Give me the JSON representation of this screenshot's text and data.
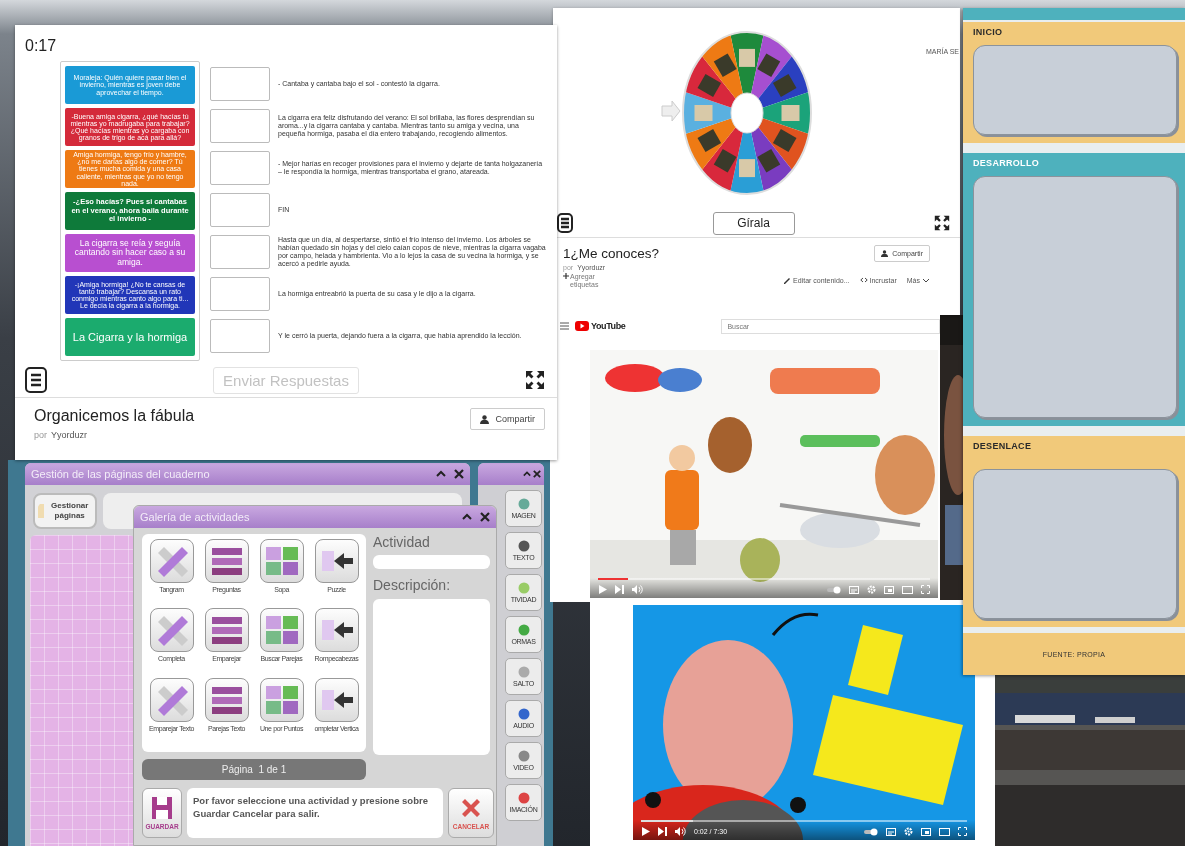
{
  "quiz": {
    "timer": "0:17",
    "cards": [
      {
        "kind": "dense",
        "color": "#1a9ad6",
        "text": "Moraleja: Quién quiere pasar bien el invierno, mientras es joven debe aprovechar el tiempo."
      },
      {
        "kind": "dense",
        "color": "#d42a3a",
        "text": "-Buena amiga cigarra, ¿qué hacías tú mientras yo madrugaba para trabajar? ¿Qué hacías mientras yo cargaba con granos de trigo de acá para allá?"
      },
      {
        "kind": "dense",
        "color": "#ee7a14",
        "text": "Amiga hormiga, tengo frío y hambre, ¿no me darías algo de comer? Tú tienes mucha comida y una casa caliente, mientras que yo no tengo nada."
      },
      {
        "kind": "short",
        "color": "#0e7a3a",
        "text": "-¿Eso hacías? Pues si cantabas en el verano, ahora baila durante el invierno -"
      },
      {
        "kind": "medium",
        "color": "#b84fd0",
        "text": "La cigarra se reía y seguía cantando sin hacer caso a su amiga."
      },
      {
        "kind": "dense",
        "color": "#2136b8",
        "text": "-¡Amiga hormiga! ¿No te cansas de tanto trabajar? Descansa un rato conmigo mientras canto algo para ti... Le decía la cigarra a la hormiga."
      },
      {
        "kind": "heading",
        "color": "#1bab6e",
        "text": "La Cigarra y la hormiga"
      }
    ],
    "slots": [
      {
        "text": "- Cantaba y cantaba bajo el sol - contestó la cigarra."
      },
      {
        "text": "La cigarra era feliz disfrutando del verano: El sol brillaba, las flores desprendían su aroma...y la cigarra cantaba y cantaba. Mientras tanto su amiga y vecina, una pequeña hormiga, pasaba el día entero trabajando, recogiendo alimentos."
      },
      {
        "text": "- Mejor harías en recoger provisiones para el invierno y dejarte de tanta holgazanería – le respondía la hormiga, mientras transportaba el grano, atareada."
      },
      {
        "text": "FIN"
      },
      {
        "text": "Hasta que un día, al despertarse, sintió el frío intenso del invierno. Los árboles se habían quedado sin hojas y del cielo caían copos de nieve, mientras la cigarra vagaba por campo, helada y hambrienta. Vio a lo lejos la casa de su vecina la hormiga, y se acercó a pedirle ayuda."
      },
      {
        "text": "La hormiga entreabrió la puerta de su casa y le dijo a la cigarra."
      },
      {
        "text": "Y le cerró la puerta, dejando fuera a la cigarra, que había aprendido la lección."
      }
    ],
    "submit": {
      "label": "Enviar Respuestas",
      "disabled": true
    },
    "title": "Organicemos la fábula",
    "byline": "por",
    "author": "Yyorduzr",
    "share": "Compartir"
  },
  "wheel": {
    "corner_text": "MARÍA SE",
    "spin_button": "Gírala",
    "title": "1¿Me conoces?",
    "byline": "por",
    "author": "Yyorduzr",
    "share": "Compartir",
    "add_tags": "Agregar etiquetas",
    "actions": [
      {
        "kind": "edit",
        "label": "Editar contenido..."
      },
      {
        "kind": "embed",
        "label": "Incrustar"
      },
      {
        "kind": "more",
        "label": "Más"
      }
    ]
  },
  "video_1": {
    "site": "YouTube",
    "search_placeholder": "Buscar",
    "progress": {
      "level": 0.09
    }
  },
  "video_2": {
    "time": "0:02 / 7:30",
    "progress": {
      "level": 0.16
    }
  },
  "organizer": {
    "sections": [
      {
        "label": "INICIO",
        "color": "#f1c97a"
      },
      {
        "label": "DESARROLLO",
        "color": "#4eb1bd"
      },
      {
        "label": "DESENLACE",
        "color": "#f1c97a"
      }
    ],
    "footer": "FUENTE: PROPIA"
  },
  "notebook": {
    "title": "Gestión de las páginas del cuaderno",
    "manage_button": "Gestionar páginas"
  },
  "tools": {
    "buttons": [
      "MAGEN",
      "TEXTO",
      "TIVIDAD",
      "ORMAS",
      "SALTO",
      "AUDIO",
      "VIDEO",
      "IMACIÓN"
    ]
  },
  "gallery": {
    "title": "Galería de actividades",
    "activities": [
      "Tangram",
      "Preguntas",
      "Sopa",
      "Puzzle",
      "Completa",
      "Emparejar",
      "Buscar Parejas",
      "Rompecabezas",
      "Emparejar Texto",
      "Parejas Texto",
      "Une por Puntos",
      "ompletar Vertica"
    ],
    "activity_label": "Actividad",
    "description_label": "Descripción:",
    "pager": "Página  1 de 1",
    "message": "Por favor seleccione una actividad y presione sobre Guardar Cancelar para salir.",
    "save": "GUARDAR",
    "cancel": "CANCELAR"
  }
}
